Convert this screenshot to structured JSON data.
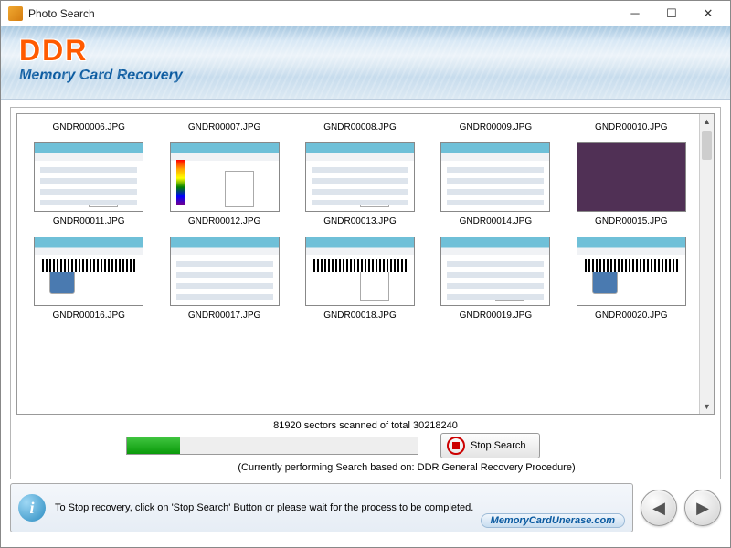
{
  "window": {
    "title": "Photo Search"
  },
  "banner": {
    "logo": "DDR",
    "subtitle": "Memory Card Recovery"
  },
  "files": [
    {
      "name": "GNDR00006.JPG",
      "style": "label"
    },
    {
      "name": "GNDR00007.JPG",
      "style": "label"
    },
    {
      "name": "GNDR00008.JPG",
      "style": "label"
    },
    {
      "name": "GNDR00009.JPG",
      "style": "label"
    },
    {
      "name": "GNDR00010.JPG",
      "style": "label"
    },
    {
      "name": "GNDR00011.JPG",
      "style": "app"
    },
    {
      "name": "GNDR00012.JPG",
      "style": "app colors"
    },
    {
      "name": "GNDR00013.JPG",
      "style": "app"
    },
    {
      "name": "GNDR00014.JPG",
      "style": "app card"
    },
    {
      "name": "GNDR00015.JPG",
      "style": "solid"
    },
    {
      "name": "GNDR00016.JPG",
      "style": "app id barcode"
    },
    {
      "name": "GNDR00017.JPG",
      "style": "app id2"
    },
    {
      "name": "GNDR00018.JPG",
      "style": "app barcode"
    },
    {
      "name": "GNDR00019.JPG",
      "style": "app"
    },
    {
      "name": "GNDR00020.JPG",
      "style": "app id barcode"
    }
  ],
  "progress": {
    "sectors_scanned": 81920,
    "sectors_total": 30218240,
    "status_line": "81920 sectors scanned of total 30218240",
    "procedure_line": "(Currently performing Search based on:  DDR General Recovery Procedure)"
  },
  "buttons": {
    "stop": "Stop Search"
  },
  "footer": {
    "hint": "To Stop recovery, click on 'Stop Search' Button or please wait for the process to be completed.",
    "url": "MemoryCardUnerase.com"
  }
}
